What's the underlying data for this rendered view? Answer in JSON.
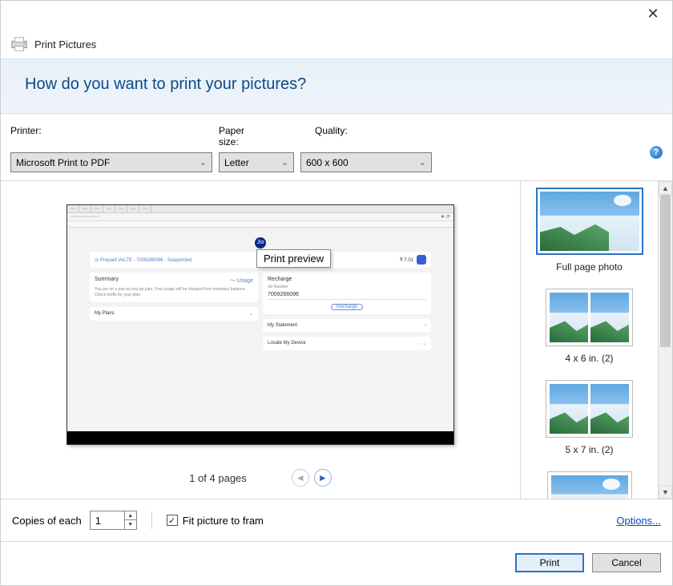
{
  "title": "Print Pictures",
  "heading": "How do you want to print your pictures?",
  "labels": {
    "printer": "Printer:",
    "paper_size": "Paper size:",
    "quality": "Quality:",
    "copies": "Copies of each",
    "fit_picture": "Fit picture to fram",
    "options": "Options..."
  },
  "values": {
    "printer": "Microsoft Print to PDF",
    "paper_size": "Letter",
    "quality": "600 x 600",
    "copies": "1",
    "fit_checked": true
  },
  "tooltip": "Print preview",
  "pager": "1 of 4 pages",
  "layouts": [
    {
      "label": "Full page photo",
      "selected": true,
      "type": "full"
    },
    {
      "label": "4 x 6 in.  (2)",
      "selected": false,
      "type": "double"
    },
    {
      "label": "5 x 7 in.  (2)",
      "selected": false,
      "type": "double"
    },
    {
      "label": "",
      "selected": false,
      "type": "wide"
    }
  ],
  "buttons": {
    "print": "Print",
    "cancel": "Cancel"
  },
  "preview_content": {
    "logo": "Jio",
    "plan_line": "Prepaid VoLTE - 7009266096 - Suspended",
    "balance": "₹ 7.01",
    "summary_title": "Summary",
    "usage_link": "Usage",
    "summary_text": "You are on a pay-as-you-go plan. Your usage will be charged from monetary balance. Check tariffs for your plan.",
    "my_plans": "My Plans",
    "recharge_title": "Recharge",
    "jio_number_label": "Jio Number",
    "jio_number": "7009266096",
    "recharge_btn": "Recharge",
    "my_statement": "My Statement",
    "locate_device": "Locate My Device"
  }
}
